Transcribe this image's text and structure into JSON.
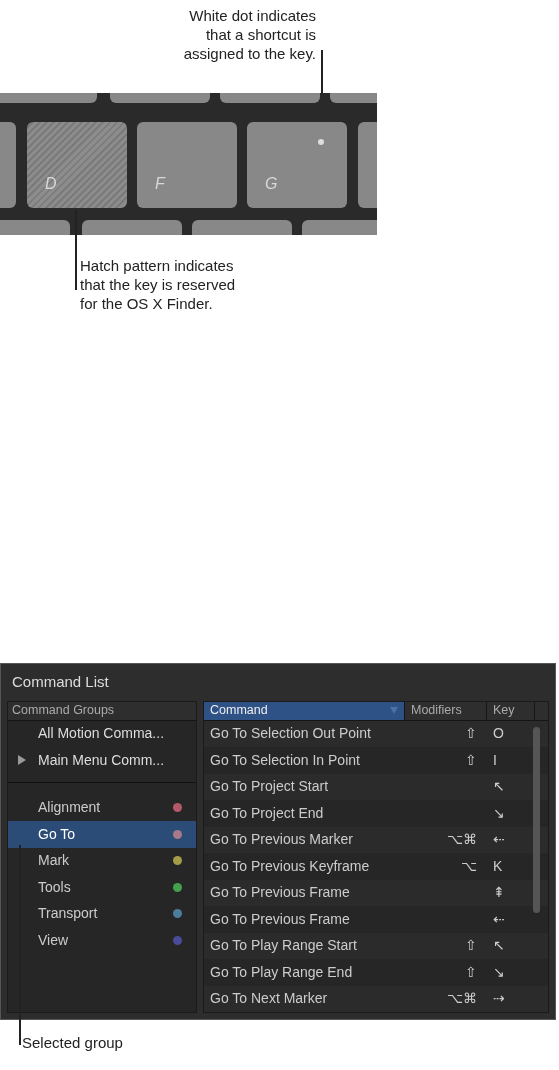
{
  "annotations": {
    "dot_callout": [
      "White dot indicates",
      "that a shortcut is",
      "assigned to the key."
    ],
    "hatch_callout": [
      "Hatch pattern indicates",
      "that the key is reserved",
      "for the OS X Finder."
    ],
    "selected_callout": "Selected group"
  },
  "keyboard": {
    "keys": [
      {
        "label": "D",
        "reserved": true,
        "assigned": false
      },
      {
        "label": "F",
        "reserved": false,
        "assigned": false
      },
      {
        "label": "G",
        "reserved": false,
        "assigned": true
      }
    ]
  },
  "command_list": {
    "title": "Command List",
    "groups_header": "Command Groups",
    "collections": [
      {
        "label": "All Motion Comma...",
        "kind": "all"
      },
      {
        "label": "Main Menu Comm...",
        "kind": "folder"
      }
    ],
    "groups": [
      {
        "label": "Alignment",
        "color": "#b4586a",
        "selected": false
      },
      {
        "label": "Go To",
        "color": "#a67a88",
        "selected": true
      },
      {
        "label": "Mark",
        "color": "#a69c48",
        "selected": false
      },
      {
        "label": "Tools",
        "color": "#44a04e",
        "selected": false
      },
      {
        "label": "Transport",
        "color": "#4c7d9e",
        "selected": false
      },
      {
        "label": "View",
        "color": "#4a4c9a",
        "selected": false
      }
    ],
    "columns": [
      {
        "label": "Command",
        "sorted": true
      },
      {
        "label": "Modifiers",
        "sorted": false
      },
      {
        "label": "Key",
        "sorted": false
      }
    ],
    "rows": [
      [
        "Go To Selection Out Point",
        "⇧",
        "O"
      ],
      [
        "Go To Selection In Point",
        "⇧",
        "I"
      ],
      [
        "Go To Project Start",
        "",
        "↖"
      ],
      [
        "Go To Project End",
        "",
        "↘"
      ],
      [
        "Go To Previous Marker",
        "⌥⌘",
        "⇠"
      ],
      [
        "Go To Previous Keyframe",
        "⌥",
        "K"
      ],
      [
        "Go To Previous Frame",
        "",
        "⇞"
      ],
      [
        "Go To Previous Frame",
        "",
        "⇠"
      ],
      [
        "Go To Play Range Start",
        "⇧",
        "↖"
      ],
      [
        "Go To Play Range End",
        "⇧",
        "↘"
      ],
      [
        "Go To Next Marker",
        "⌥⌘",
        "⇢"
      ]
    ]
  }
}
